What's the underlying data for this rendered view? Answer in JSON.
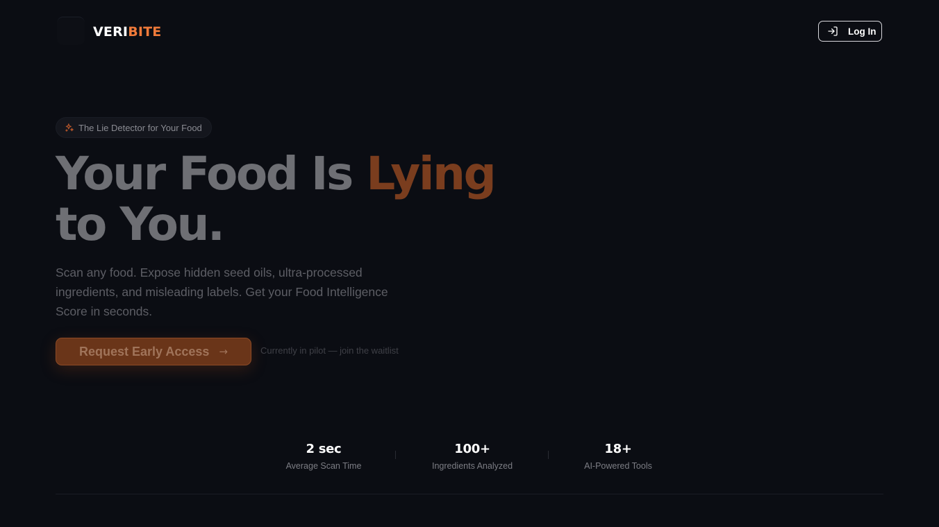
{
  "header": {
    "brand_part1": "VERI",
    "brand_part2": "BITE",
    "login_label": "Log In",
    "login_icon": "log-in-icon"
  },
  "hero": {
    "badge_icon": "sparkles-icon",
    "badge_text": "The Lie Detector for Your Food",
    "headline_part1": "Your Food Is ",
    "headline_accent": "Lying",
    "headline_part2": " to You.",
    "subtitle": "Scan any food. Expose hidden seed oils, ultra-processed ingredients, and misleading labels. Get your Food Intelligence Score in seconds.",
    "cta_label": "Request Early Access",
    "cta_icon": "arrow-right-icon",
    "cta_note": "Currently in pilot — join the waitlist"
  },
  "stats": [
    {
      "value": "2 sec",
      "label": "Average Scan Time"
    },
    {
      "value": "100+",
      "label": "Ingredients Analyzed"
    },
    {
      "value": "18+",
      "label": "AI-Powered Tools"
    }
  ],
  "colors": {
    "background": "#0b0d13",
    "accent": "#f07a3a",
    "accent_dim": "#7a3d1e",
    "cta_background": "#6a3519",
    "text_primary": "#ffffff",
    "text_muted": "#7c7d84"
  }
}
